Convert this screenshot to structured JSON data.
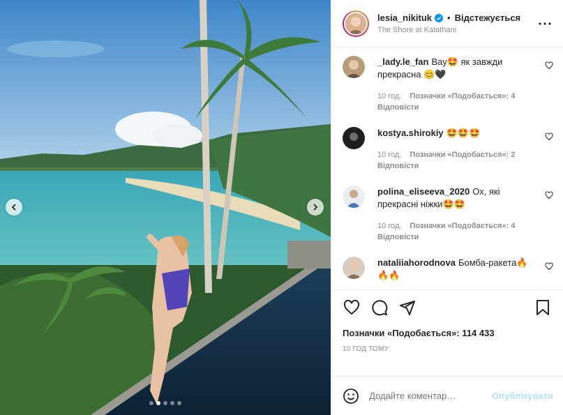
{
  "post": {
    "username": "lesia_nikituk",
    "follow_status": "Відстежується",
    "separator": "•",
    "location": "The Shore at Katathani"
  },
  "comments": [
    {
      "user": "_lady.le_fan",
      "text": "Вау🤩 як завжди прекрасна 😊🖤",
      "time": "10 год.",
      "likes": "Позначки «Подобається»: 4",
      "reply": "Відповісти"
    },
    {
      "user": "kostya.shirokiy",
      "text": "🤩🤩🤩",
      "time": "10 год.",
      "likes": "Позначки «Подобається»: 2",
      "reply": "Відповісти"
    },
    {
      "user": "polina_eliseeva_2020",
      "text": "Ох, які прекрасні ніжки🤩🤩",
      "time": "10 год.",
      "likes": "Позначки «Подобається»: 4",
      "reply": "Відповісти"
    },
    {
      "user": "nataliiahorodnova",
      "text": "Бомба-ракета🔥🔥🔥",
      "time": "",
      "likes": "",
      "reply": ""
    }
  ],
  "actions": {
    "likes_count": "Позначки «Подобається»: 114 433",
    "posted_time": "10 ГОД ТОМУ"
  },
  "add_comment": {
    "placeholder": "Додайте коментар…",
    "publish_label": "Опублікувати"
  },
  "carousel": {
    "total": 5,
    "active_index": 1
  },
  "colors": {
    "verified": "#0095f6",
    "publish_disabled": "#b2dffc",
    "meta_gray": "#8e8e8e"
  },
  "icons": [
    "chevron-left-icon",
    "chevron-right-icon",
    "verified-badge-icon",
    "more-options-icon",
    "heart-icon",
    "comment-icon",
    "share-icon",
    "bookmark-icon",
    "emoji-icon"
  ]
}
